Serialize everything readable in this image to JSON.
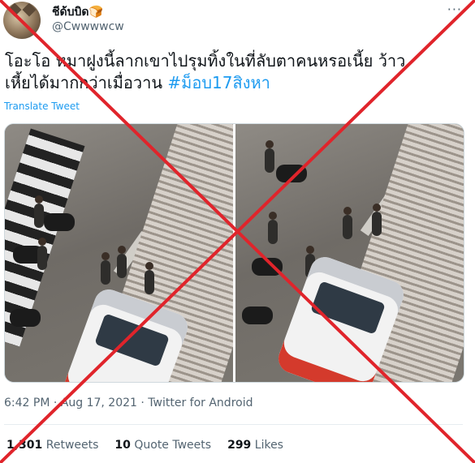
{
  "author": {
    "display_name": "ชีด้บบิด🍞",
    "handle": "@Cwwwwcw",
    "more_icon": "ellipsis-icon"
  },
  "tweet": {
    "text_line1": "โอะโอ หมาฝูงนี้ลากเขาไปรุมทิ้งในที่ลับตาคนหรอเนี้ย ว้าว",
    "text_line2_prefix": "เหี้ยได้มากกว่าเมื่อวาน ",
    "hashtag": "#ม็อบ17สิงหา",
    "translate_label": "Translate Tweet"
  },
  "meta": {
    "time": "6:42 PM",
    "date": "Aug 17, 2021",
    "source": "Twitter for Android",
    "separator": "·"
  },
  "stats": {
    "retweets_count": "1,301",
    "retweets_label": "Retweets",
    "quotes_count": "10",
    "quotes_label": "Quote Tweets",
    "likes_count": "299",
    "likes_label": "Likes"
  },
  "colors": {
    "link": "#1d9bf0",
    "x_overlay": "#e0242b"
  }
}
